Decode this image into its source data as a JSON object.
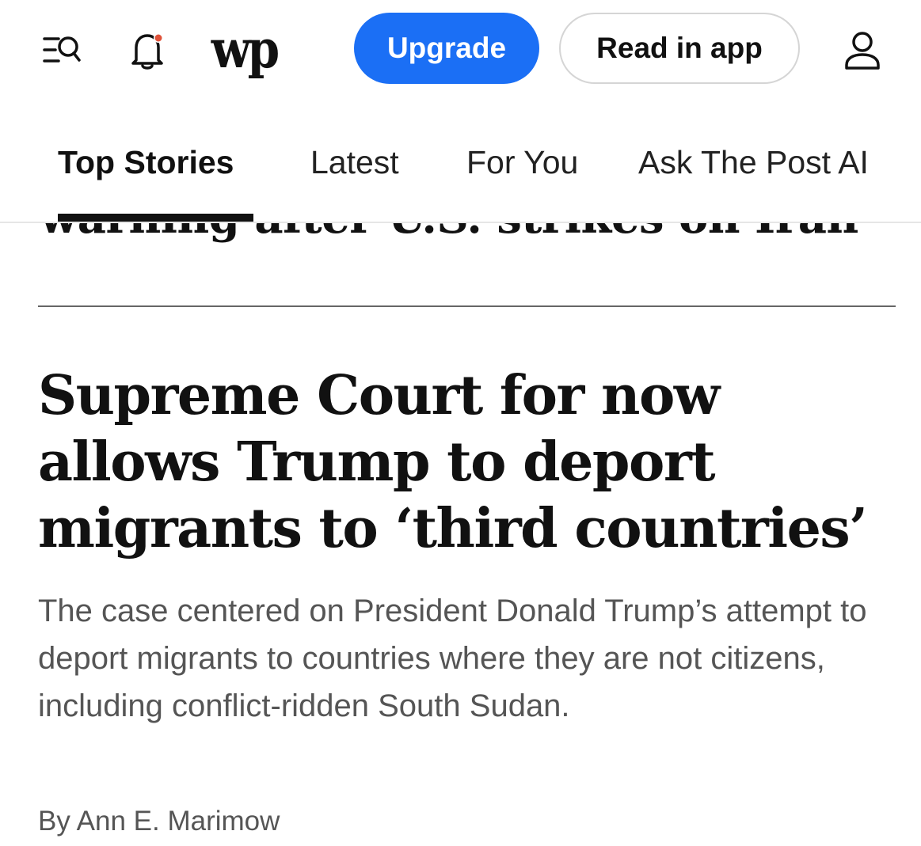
{
  "header": {
    "upgrade_label": "Upgrade",
    "read_in_app_label": "Read in app",
    "logo_text": "wp",
    "notification_dot_color": "#e0523a",
    "upgrade_color": "#1b6ff5"
  },
  "tabs": [
    {
      "label": "Top Stories",
      "active": true
    },
    {
      "label": "Latest",
      "active": false
    },
    {
      "label": "For You",
      "active": false
    },
    {
      "label": "Ask The Post AI",
      "active": false
    }
  ],
  "previous_story": {
    "headline_fragment": "warning after U.S. strikes on Iran"
  },
  "story": {
    "headline": "Supreme Court for now allows Trump to deport migrants to ‘third countries’",
    "dek": "The case centered on President Donald Trump’s attempt to deport migrants to countries where they are not citizens, including conflict-ridden South Sudan.",
    "byline_prefix": "By",
    "author": "Ann E. Marimow"
  },
  "icons": {
    "menu_search": "menu-search-icon",
    "bell": "bell-icon",
    "account": "account-icon"
  }
}
